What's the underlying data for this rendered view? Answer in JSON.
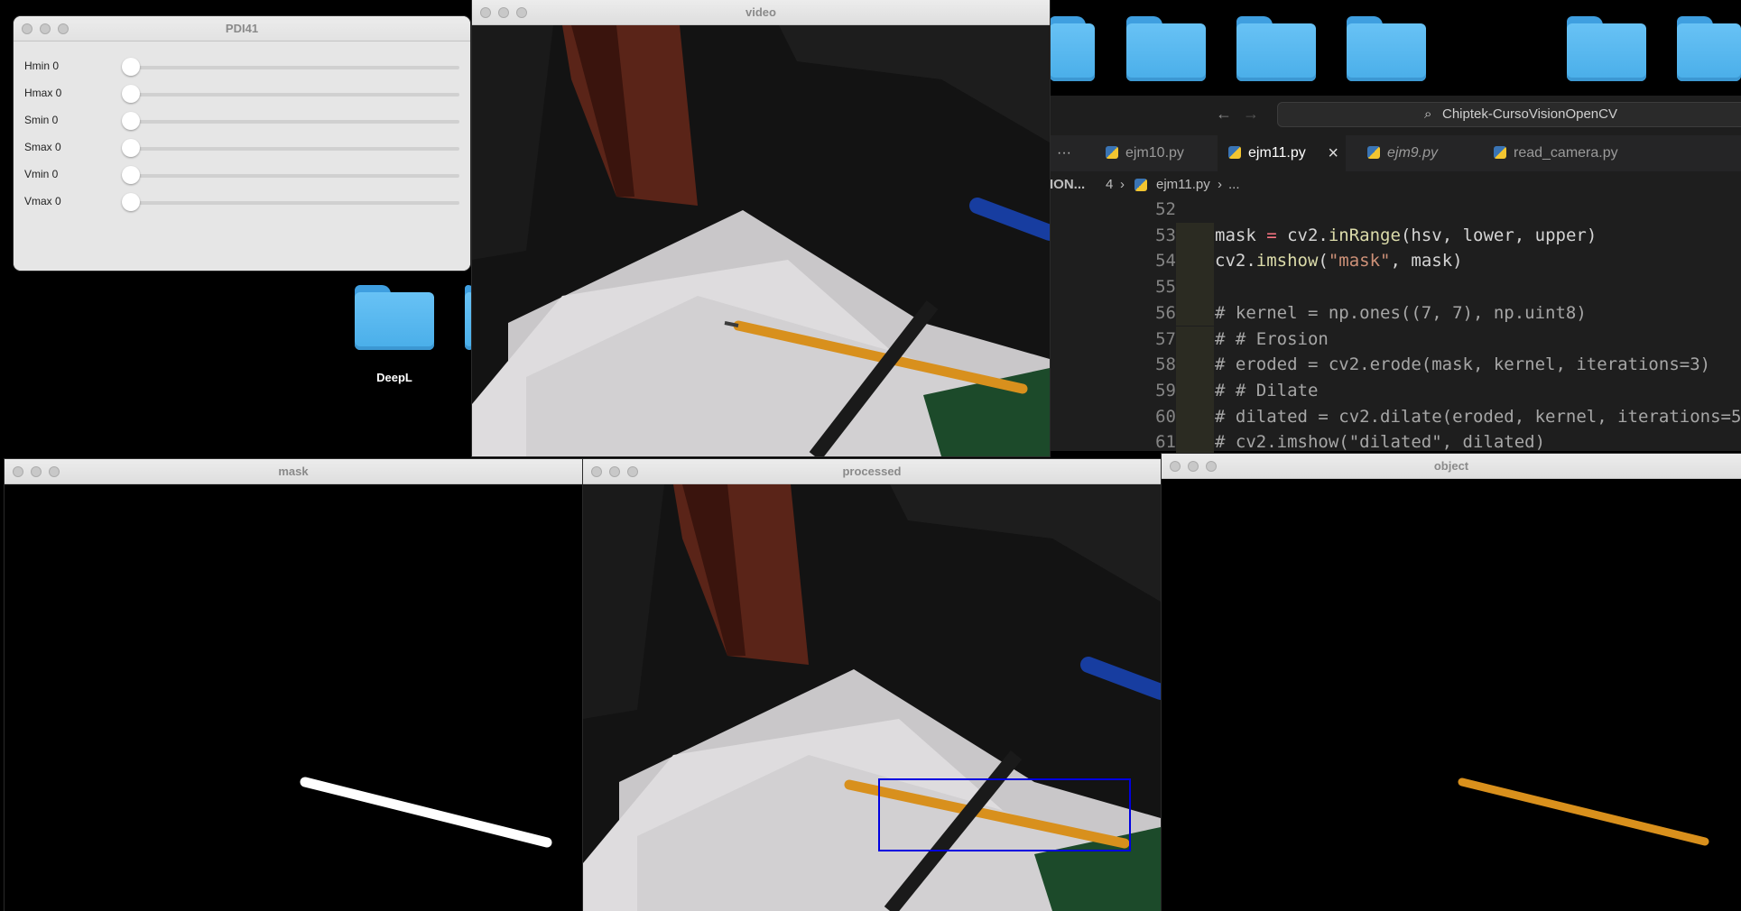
{
  "desktop": {
    "folders": [
      {
        "label": "DeepL"
      }
    ]
  },
  "windows": {
    "trackbars": {
      "title": "PDI41",
      "sliders": [
        {
          "label": "Hmin 0",
          "value": 0
        },
        {
          "label": "Hmax 0",
          "value": 0
        },
        {
          "label": "Smin 0",
          "value": 0
        },
        {
          "label": "Smax 0",
          "value": 0
        },
        {
          "label": "Vmin 0",
          "value": 0
        },
        {
          "label": "Vmax 0",
          "value": 0
        }
      ]
    },
    "video": {
      "title": "video"
    },
    "mask": {
      "title": "mask"
    },
    "processed": {
      "title": "processed",
      "bbox_color": "#0000e0"
    },
    "object": {
      "title": "object",
      "object_color": "#d9901c"
    }
  },
  "editor": {
    "search": "Chiptek-CursoVisionOpenCV",
    "overflow": "···",
    "tabs": [
      {
        "label": "ejm10.py",
        "active": false
      },
      {
        "label": "ejm11.py",
        "active": true
      },
      {
        "label": "ejm9.py",
        "active": false
      },
      {
        "label": "read_camera.py",
        "active": false
      }
    ],
    "close_icon": "×",
    "breadcrumb": {
      "left": "ION...",
      "folder": "4",
      "file": "ejm11.py",
      "rest": "..."
    },
    "lines": [
      {
        "n": "52",
        "text": ""
      },
      {
        "n": "53",
        "text": "mask = cv2.inRange(hsv, lower, upper)"
      },
      {
        "n": "54",
        "text": "cv2.imshow(\"mask\", mask)"
      },
      {
        "n": "55",
        "text": ""
      },
      {
        "n": "56",
        "text": "# kernel = np.ones((7, 7), np.uint8)"
      },
      {
        "n": "57",
        "text": "# # Erosion"
      },
      {
        "n": "58",
        "text": "# eroded = cv2.erode(mask, kernel, iterations=3)"
      },
      {
        "n": "59",
        "text": "# # Dilate"
      },
      {
        "n": "60",
        "text": "# dilated = cv2.dilate(eroded, kernel, iterations=5"
      },
      {
        "n": "61",
        "text": "# cv2.imshow(\"dilated\", dilated)"
      }
    ]
  }
}
